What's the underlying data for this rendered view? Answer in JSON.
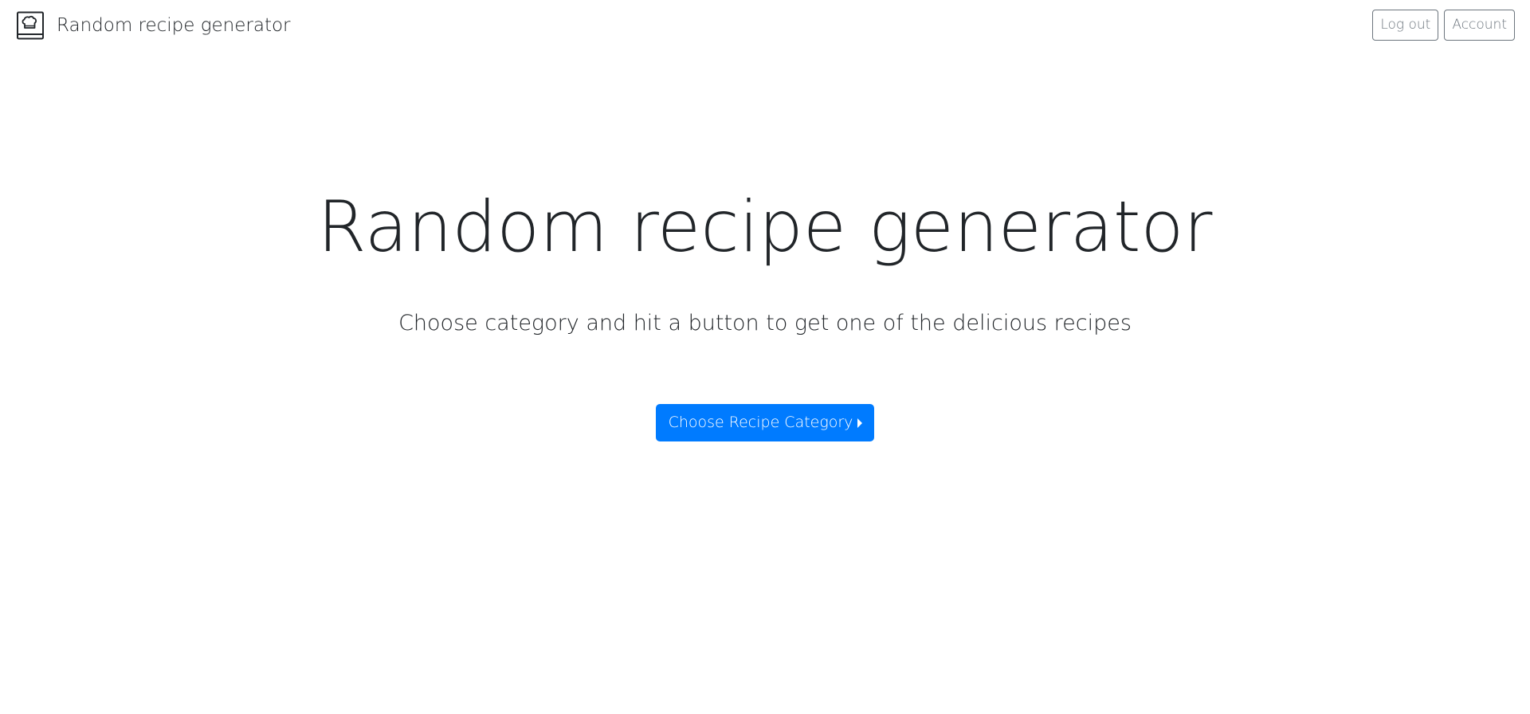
{
  "navbar": {
    "brand_icon": "recipe-book-chef-hat-icon",
    "brand_label": "Random recipe generator",
    "logout_label": "Log out",
    "account_label": "Account"
  },
  "hero": {
    "title": "Random recipe generator",
    "lead": "Choose category and hit a button to get one of the delicious recipes",
    "cta_label": "Choose Recipe Category",
    "cta_icon": "caret-right-icon"
  },
  "colors": {
    "primary": "#007bff",
    "secondary": "#6c757d",
    "text": "#212529",
    "background": "#ffffff"
  }
}
